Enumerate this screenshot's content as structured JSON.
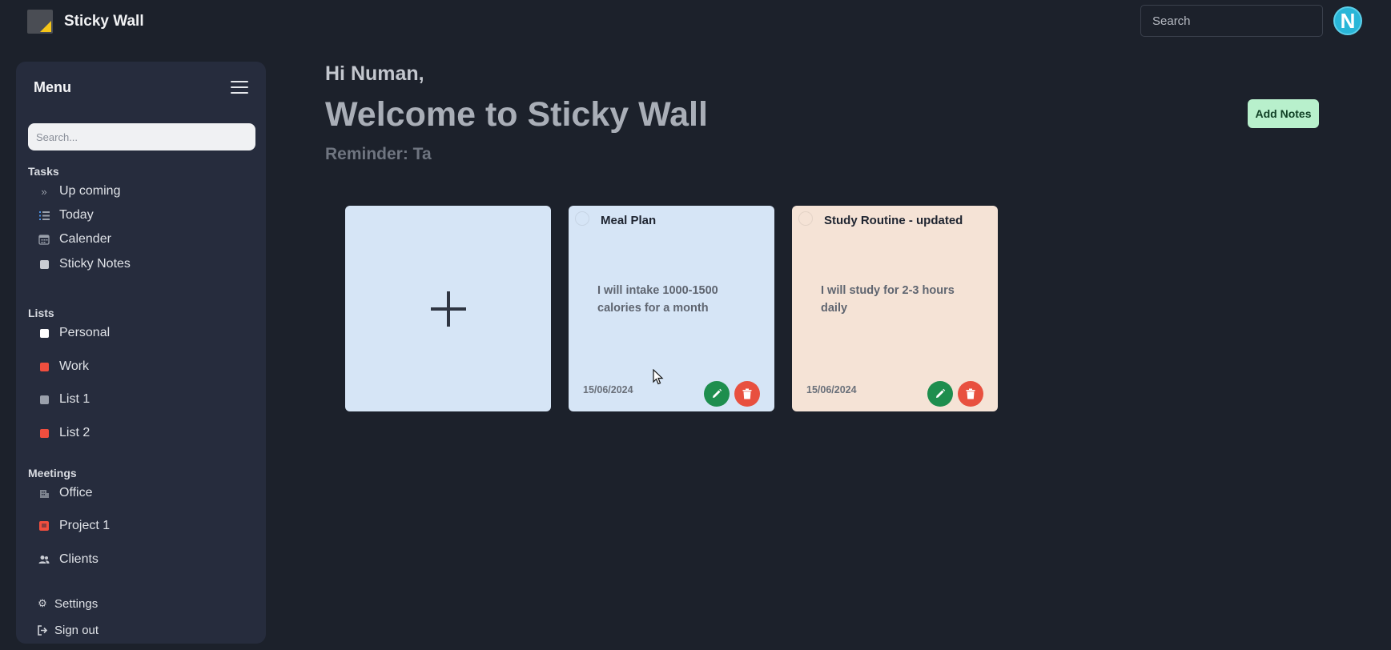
{
  "app": {
    "title": "Sticky Wall",
    "search_placeholder": "Search",
    "avatar_initial": "N"
  },
  "sidebar": {
    "menu_title": "Menu",
    "search_placeholder": "Search...",
    "sections": {
      "tasks": "Tasks",
      "lists": "Lists",
      "meetings": "Meetings"
    },
    "tasks": [
      {
        "label": "Up coming",
        "icon": "double-chevron-right-icon"
      },
      {
        "label": "Today",
        "icon": "list-icon"
      },
      {
        "label": "Calender",
        "icon": "calendar-icon"
      },
      {
        "label": "Sticky Notes",
        "icon": "sticky-note-icon"
      }
    ],
    "lists": [
      {
        "label": "Personal",
        "color": "#ffffff"
      },
      {
        "label": "Work",
        "color": "#f04e3e"
      },
      {
        "label": "List 1",
        "color": "#9aa0ab"
      },
      {
        "label": "List 2",
        "color": "#f04e3e"
      }
    ],
    "meetings": [
      {
        "label": "Office",
        "icon": "building-icon"
      },
      {
        "label": "Project 1",
        "icon": "project-icon"
      },
      {
        "label": "Clients",
        "icon": "users-icon"
      }
    ],
    "footer": {
      "settings": "Settings",
      "signout": "Sign out"
    }
  },
  "main": {
    "greeting": "Hi Numan,",
    "welcome": "Welcome to Sticky Wall",
    "reminder": "Reminder: Ta",
    "add_notes_label": "Add Notes",
    "notes": [
      {
        "title": "Meal Plan",
        "body": "I will intake 1000-1500 calories for a month",
        "date": "15/06/2024",
        "color": "#d6e5f6"
      },
      {
        "title": "Study Routine - updated",
        "body": "I will study for 2-3 hours daily",
        "date": "15/06/2024",
        "color": "#f5e3d6"
      }
    ]
  },
  "colors": {
    "background": "#1c212b",
    "sidebar": "#262c3d",
    "add_button": "#b8f0cc",
    "edit": "#1e8e4e",
    "delete": "#e8503f",
    "avatar": "#29b6d8"
  }
}
